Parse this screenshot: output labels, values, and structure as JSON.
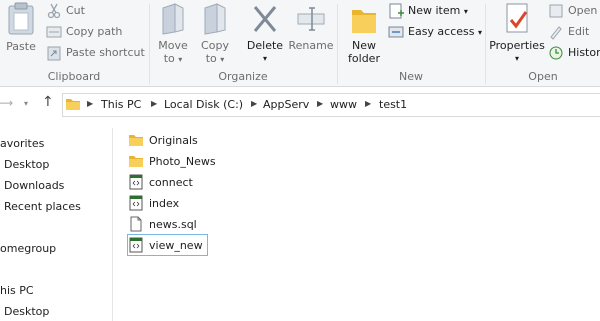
{
  "ribbon": {
    "clipboard": {
      "paste": "Paste",
      "cut": "Cut",
      "copy_path": "Copy path",
      "paste_shortcut": "Paste shortcut",
      "label": "Clipboard"
    },
    "organize": {
      "move_to": "Move",
      "move_to_2": "to",
      "copy_to": "Copy",
      "copy_to_2": "to",
      "delete": "Delete",
      "rename": "Rename",
      "label": "Organize"
    },
    "new": {
      "new_folder": "New",
      "new_folder_2": "folder",
      "new_item": "New item",
      "easy_access": "Easy access",
      "label": "New"
    },
    "open": {
      "properties": "Properties",
      "open": "Open",
      "edit": "Edit",
      "history": "History",
      "label": "Open"
    }
  },
  "address": {
    "crumbs": [
      "This PC",
      "Local Disk (C:)",
      "AppServ",
      "www",
      "test1"
    ]
  },
  "nav": {
    "items": [
      "avorites",
      "Desktop",
      "Downloads",
      "Recent places",
      "omegroup",
      "his PC",
      "Desktop"
    ]
  },
  "files": [
    {
      "name": "Originals",
      "icon": "folder-icon"
    },
    {
      "name": "Photo_News",
      "icon": "folder-icon"
    },
    {
      "name": "connect",
      "icon": "php-file-icon"
    },
    {
      "name": "index",
      "icon": "php-file-icon"
    },
    {
      "name": "news.sql",
      "icon": "blank-file-icon"
    },
    {
      "name": "view_new",
      "icon": "php-file-icon",
      "selected": true
    }
  ],
  "colors": {
    "ribbon_bg": "#f5f6f7",
    "folder": "#f4c445",
    "selection_border": "#79b7e6"
  }
}
